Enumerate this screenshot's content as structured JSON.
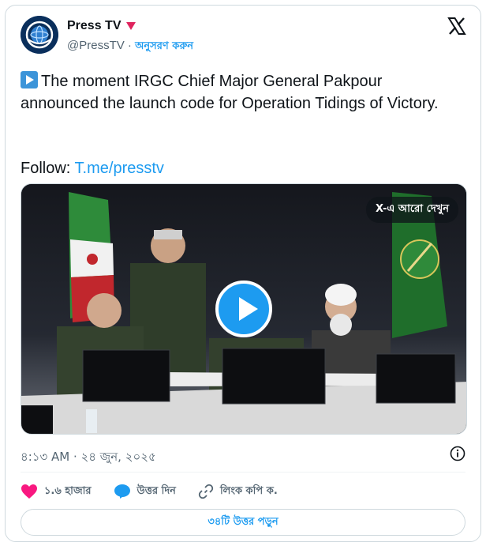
{
  "author": {
    "name": "Press TV",
    "handle": "@PressTV",
    "separator": "·",
    "follow_label": "অনুসরণ করুন",
    "badge_color": "#e0245e"
  },
  "tweet": {
    "text": "The moment IRGC Chief Major General Pakpour announced the launch code for Operation Tidings of Victory.",
    "follow_prefix": "Follow: ",
    "follow_link": "T.me/presstv"
  },
  "media": {
    "see_more_label": "X-এ আরো দেখুন"
  },
  "timestamp": "৪:১৩ AM · ২৪ জুন, ২০২৫",
  "actions": {
    "likes": "১.৬ হাজার",
    "reply_label": "উত্তর দিন",
    "copy_link_label": "লিংক কপি ক."
  },
  "read_replies_label": "৩৪টি উত্তর পড়ুন",
  "colors": {
    "accent": "#1d9bf0",
    "like": "#f91880",
    "muted": "#536471"
  }
}
